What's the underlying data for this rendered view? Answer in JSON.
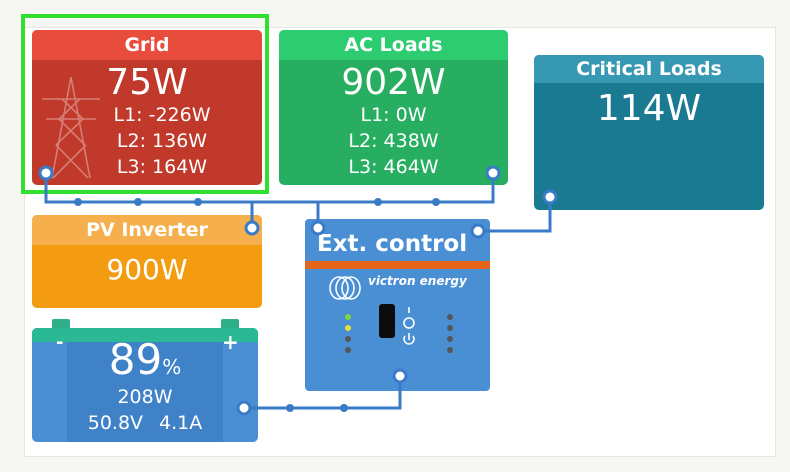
{
  "grid": {
    "title": "Grid",
    "power": "75W",
    "l1": "L1: -226W",
    "l2": "L2: 136W",
    "l3": "L3: 164W"
  },
  "ac_loads": {
    "title": "AC Loads",
    "power": "902W",
    "l1": "L1: 0W",
    "l2": "L2: 438W",
    "l3": "L3: 464W"
  },
  "critical_loads": {
    "title": "Critical Loads",
    "power": "114W"
  },
  "pv_inverter": {
    "title": "PV Inverter",
    "power": "900W"
  },
  "battery": {
    "soc_value": "89",
    "soc_unit": "%",
    "power": "208W",
    "voltage": "50.8V",
    "current": "4.1A",
    "neg_label": "-",
    "pos_label": "+"
  },
  "ext_control": {
    "title": "Ext. control",
    "brand": "victron energy",
    "icon_name": "victron-logo-icon"
  },
  "colors": {
    "grid": "#c0392b",
    "ac_loads": "#27ae60",
    "critical_loads": "#1a7a92",
    "pv_inverter": "#f39c12",
    "battery": "#4a8fd4",
    "connector": "#3a7bc8",
    "highlight": "#2fe02f"
  }
}
